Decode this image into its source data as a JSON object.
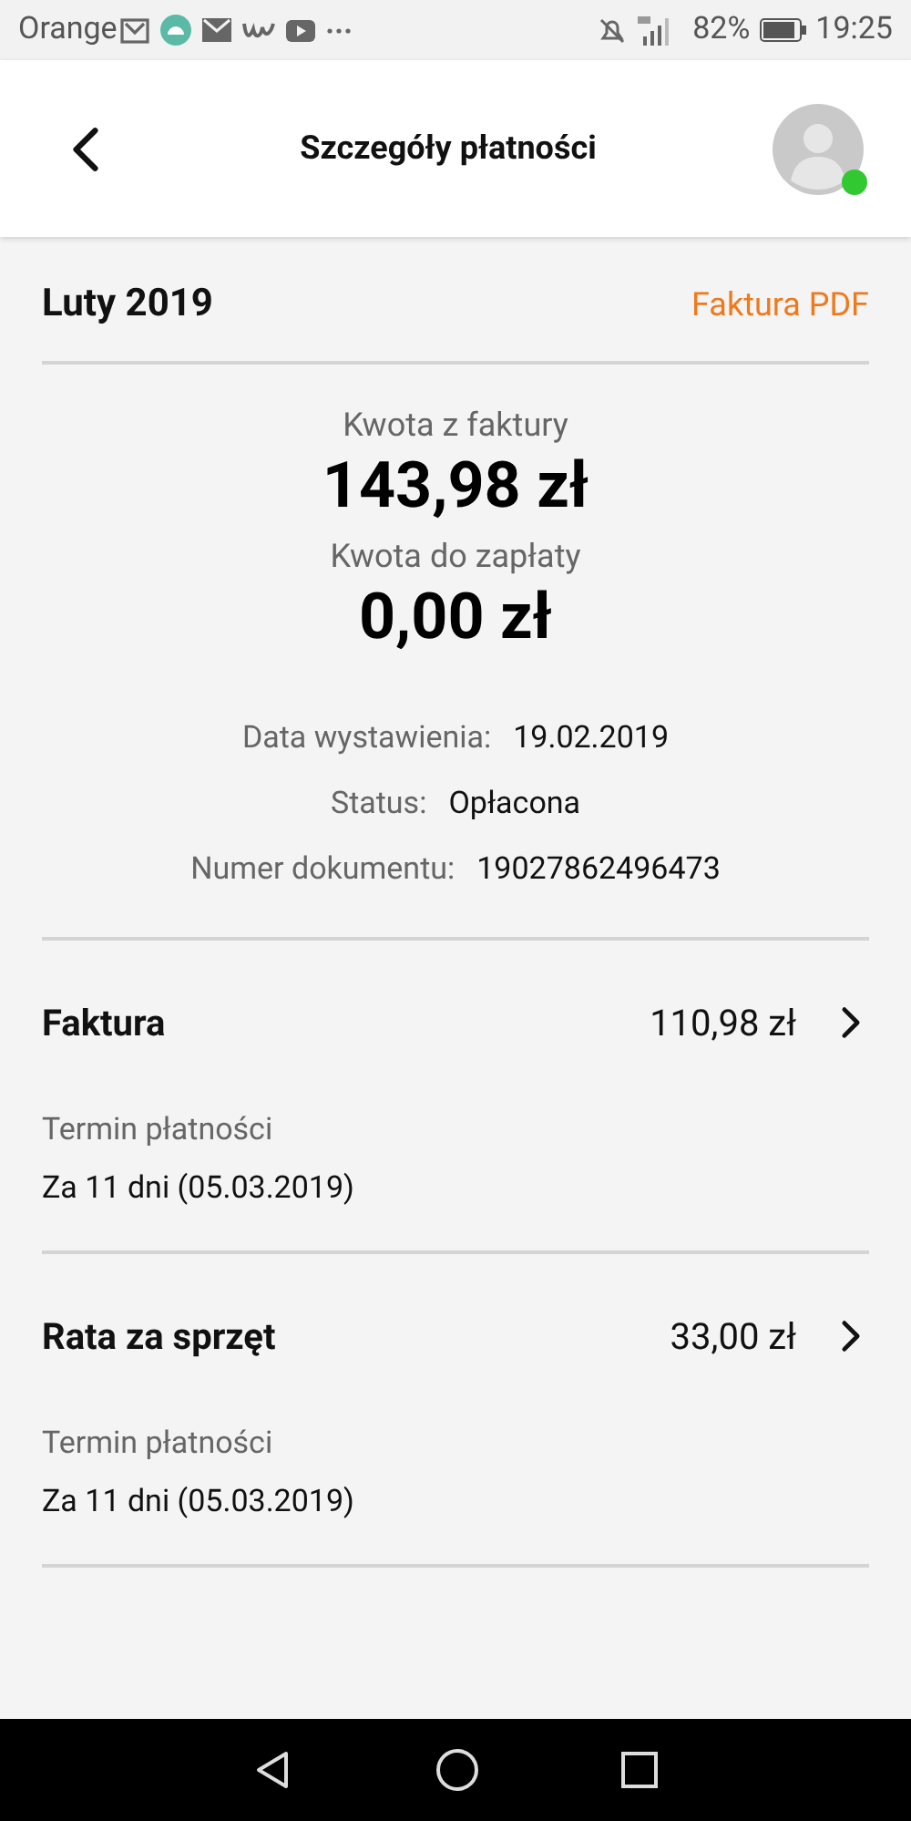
{
  "status_bar": {
    "carrier": "Orange",
    "battery": "82%",
    "time": "19:25"
  },
  "header": {
    "title": "Szczegóły płatności",
    "avatar_online": true
  },
  "invoice": {
    "period": "Luty 2019",
    "pdf_link": "Faktura PDF",
    "amounts": [
      {
        "label": "Kwota z faktury",
        "value": "143,98 zł"
      },
      {
        "label": "Kwota do zapłaty",
        "value": "0,00 zł"
      }
    ],
    "details": [
      {
        "label": "Data wystawienia:",
        "value": "19.02.2019"
      },
      {
        "label": "Status:",
        "value": "Opłacona"
      },
      {
        "label": "Numer dokumentu:",
        "value": "19027862496473"
      }
    ]
  },
  "items": [
    {
      "name": "Faktura",
      "amount": "110,98 zł",
      "due_label": "Termin płatności",
      "due_value": "Za 11 dni (05.03.2019)"
    },
    {
      "name": "Rata za sprzęt",
      "amount": "33,00 zł",
      "due_label": "Termin płatności",
      "due_value": "Za 11 dni (05.03.2019)"
    }
  ]
}
